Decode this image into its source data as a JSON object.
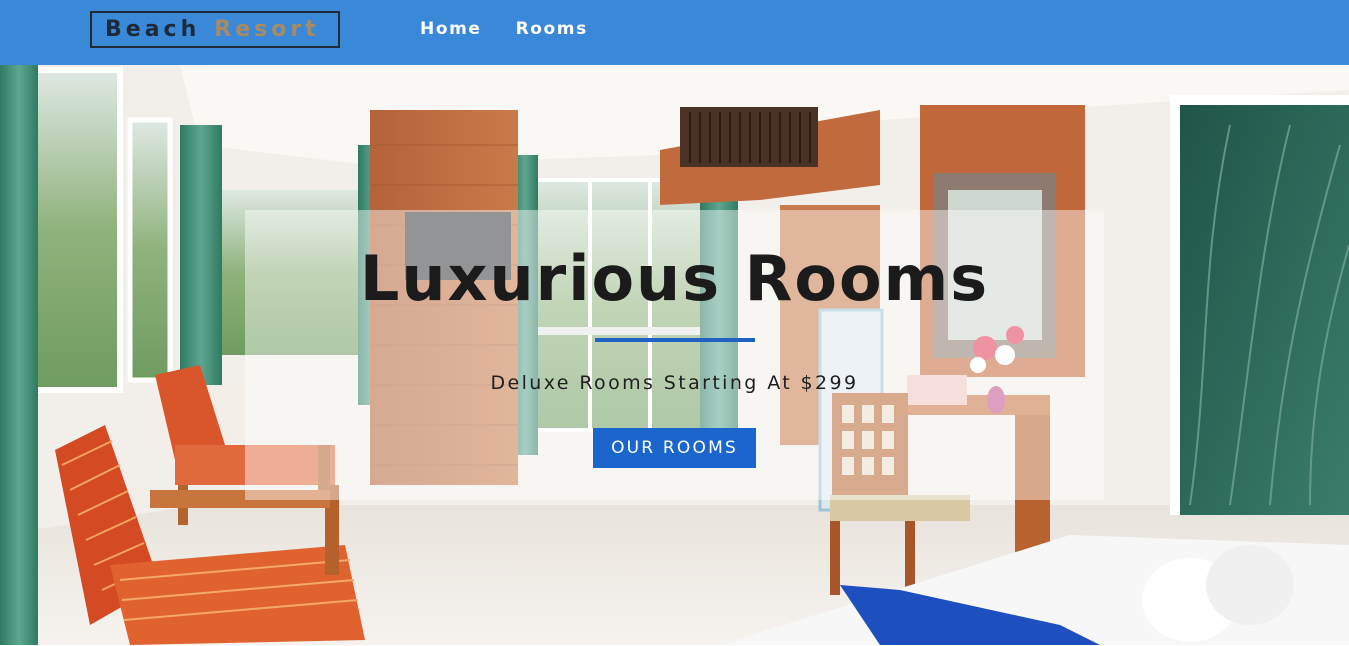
{
  "nav": {
    "logo_word1": "Beach",
    "logo_word2": "Resort",
    "links": [
      "Home",
      "Rooms"
    ]
  },
  "hero": {
    "title": "Luxurious Rooms",
    "subtitle": "Deluxe Rooms Starting At $299",
    "button_label": "OUR ROOMS"
  },
  "colors": {
    "navbar": "#3a89d9",
    "accent": "#1a66cc",
    "logo_dark": "#1c2a3b",
    "logo_gold": "#a98a63"
  }
}
